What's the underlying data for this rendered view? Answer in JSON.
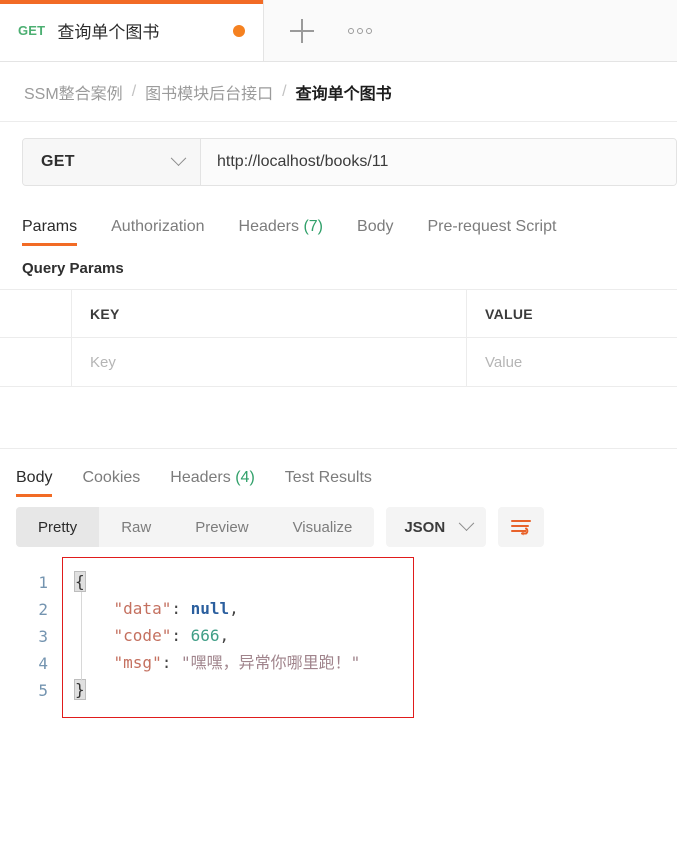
{
  "tab": {
    "method": "GET",
    "title": "查询单个图书",
    "unsaved_dot": true,
    "new_tab_icon": "plus-icon",
    "more_icon": "dots-icon",
    "accent_color": "#f26b25",
    "method_color": "#4caf72",
    "dot_color": "#f58120"
  },
  "breadcrumb": {
    "items": [
      {
        "label": "SSM整合案例",
        "current": false
      },
      {
        "label": "图书模块后台接口",
        "current": false
      },
      {
        "label": "查询单个图书",
        "current": true
      }
    ],
    "separator": "/"
  },
  "url_bar": {
    "method": "GET",
    "method_chevron": "chevron-down-icon",
    "url": "http://localhost/books/11"
  },
  "request_tabs": [
    {
      "label": "Params",
      "count": "",
      "active": true
    },
    {
      "label": "Authorization",
      "count": "",
      "active": false
    },
    {
      "label": "Headers",
      "count": "(7)",
      "active": false
    },
    {
      "label": "Body",
      "count": "",
      "active": false
    },
    {
      "label": "Pre-request Script",
      "count": "",
      "active": false
    }
  ],
  "query_params": {
    "title": "Query Params",
    "headers": {
      "key": "KEY",
      "value": "VALUE"
    },
    "rows": [
      {
        "key_placeholder": "Key",
        "value_placeholder": "Value"
      }
    ]
  },
  "response_tabs": [
    {
      "label": "Body",
      "count": "",
      "active": true
    },
    {
      "label": "Cookies",
      "count": "",
      "active": false
    },
    {
      "label": "Headers",
      "count": "(4)",
      "active": false
    },
    {
      "label": "Test Results",
      "count": "",
      "active": false
    }
  ],
  "response_toolbar": {
    "views": [
      {
        "label": "Pretty",
        "active": true
      },
      {
        "label": "Raw",
        "active": false
      },
      {
        "label": "Preview",
        "active": false
      },
      {
        "label": "Visualize",
        "active": false
      }
    ],
    "format": "JSON",
    "format_chevron": "chevron-down-icon",
    "wrap_icon": "word-wrap-icon",
    "wrap_icon_color": "#e8622a"
  },
  "response_body": {
    "line_numbers": [
      "1",
      "2",
      "3",
      "4",
      "5"
    ],
    "lines": [
      {
        "open_brace": "{"
      },
      {
        "key": "\"data\"",
        "colon": ": ",
        "null": "null",
        "comma": ","
      },
      {
        "key": "\"code\"",
        "colon": ": ",
        "num": "666",
        "comma": ","
      },
      {
        "key": "\"msg\"",
        "colon": ": ",
        "str": "\"嘿嘿，异常你哪里跑！\""
      },
      {
        "close_brace": "}"
      }
    ],
    "highlight_color": "#e01b1b"
  }
}
